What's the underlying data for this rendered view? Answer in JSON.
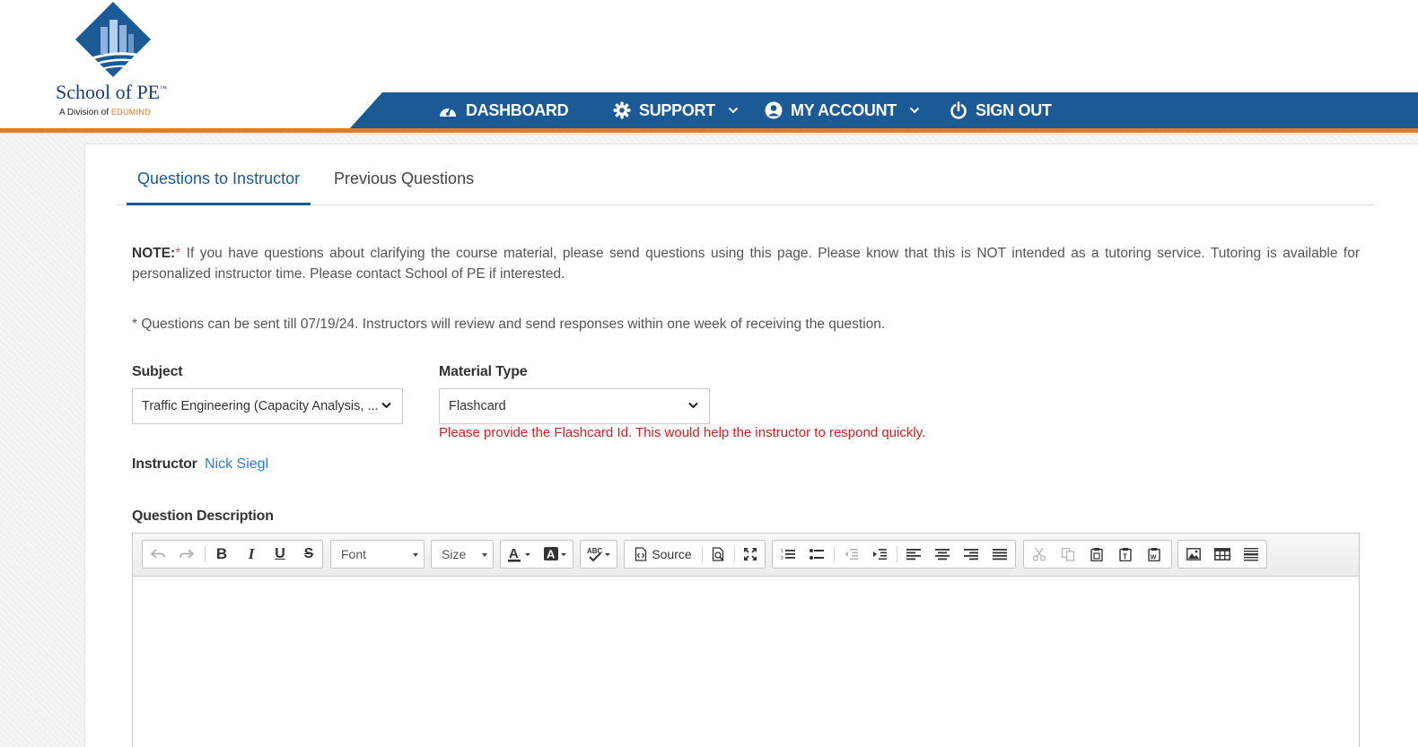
{
  "brand": {
    "name": "School of PE",
    "trademark": "™",
    "division_prefix": "A Division of",
    "division_brand": "EDUMIND",
    "colors": {
      "navy": "#1c5a96",
      "orange": "#e87722"
    }
  },
  "nav": {
    "items": [
      {
        "label": "DASHBOARD",
        "icon": "dashboard-gauge-icon"
      },
      {
        "label": "SUPPORT",
        "icon": "gear-icon",
        "dropdown": true
      },
      {
        "label": "MY ACCOUNT",
        "icon": "user-circle-icon",
        "dropdown": true
      },
      {
        "label": "SIGN OUT",
        "icon": "power-icon"
      }
    ]
  },
  "tabs": [
    {
      "label": "Questions to Instructor",
      "active": true
    },
    {
      "label": "Previous Questions",
      "active": false
    }
  ],
  "note": {
    "prefix": "NOTE:",
    "star": "*",
    "text": " If you have questions about clarifying the course material, please send questions using this page. Please know that this is NOT intended as a tutoring service. Tutoring is available for personalized instructor time. Please contact School of PE if interested."
  },
  "info": "* Questions can be sent till 07/19/24. Instructors will review and send responses within one week of receiving the question.",
  "form": {
    "subject_label": "Subject",
    "subject_value": "Traffic Engineering (Capacity Analysis, ...",
    "material_label": "Material Type",
    "material_value": "Flashcard",
    "warning": "Please provide the Flashcard Id. This would help the instructor to respond quickly.",
    "instructor_label": "Instructor",
    "instructor_name": "Nick Siegl",
    "description_label": "Question Description"
  },
  "editor": {
    "font_combo": "Font",
    "size_combo": "Size",
    "source_label": "Source",
    "icons": [
      "undo-icon",
      "redo-icon",
      "bold-icon",
      "italic-icon",
      "underline-icon",
      "strikethrough-icon",
      "text-color-icon",
      "background-color-icon",
      "spellcheck-icon",
      "source-icon",
      "preview-icon",
      "maximize-icon",
      "numbered-list-icon",
      "bulleted-list-icon",
      "outdent-icon",
      "indent-icon",
      "align-left-icon",
      "align-center-icon",
      "align-right-icon",
      "justify-icon",
      "cut-icon",
      "copy-icon",
      "paste-icon",
      "paste-text-icon",
      "paste-word-icon",
      "image-icon",
      "table-icon",
      "horizontal-rule-icon"
    ]
  }
}
